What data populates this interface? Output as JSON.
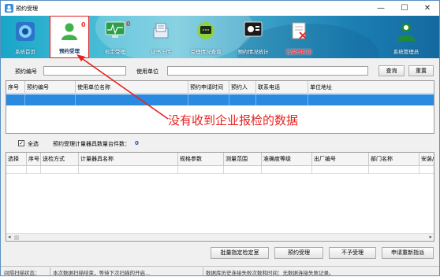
{
  "window": {
    "title": "预约受理",
    "controls": [
      "—",
      "☐",
      "✕"
    ]
  },
  "toolbar": {
    "items": [
      {
        "label": "系统首页",
        "icon": "home-icon"
      },
      {
        "label": "预约受理",
        "icon": "person-icon",
        "badge": "0",
        "active": true
      },
      {
        "label": "检定受理",
        "icon": "monitor-icon",
        "badge": "0"
      },
      {
        "label": "证书上传",
        "icon": "upload-icon"
      },
      {
        "label": "受理情况查询",
        "icon": "chat-icon"
      },
      {
        "label": "预约情况统计",
        "icon": "stats-icon"
      },
      {
        "label": "已受理打回",
        "icon": "return-icon",
        "red": true
      },
      {
        "label": "系统管理员",
        "icon": "admin-icon"
      }
    ]
  },
  "search": {
    "no_label": "预约编号",
    "unit_label": "使用单位",
    "no_value": "",
    "unit_value": "",
    "query_btn": "查询",
    "reset_btn": "重置"
  },
  "grid1": {
    "columns": [
      "序号",
      "预约编号",
      "使用单位名称",
      "预约申请时间",
      "预约人",
      "联系电话",
      "单位地址"
    ]
  },
  "annotation": {
    "message": "没有收到企业报检的数据"
  },
  "midbar": {
    "select_all_label": "全选",
    "select_all_checked": "✓",
    "count_label": "预约受理计量器具数量台件数：",
    "count_value": "0"
  },
  "grid2": {
    "columns": [
      "选择",
      "序号",
      "送检方式",
      "计量器具名称",
      "规格参数",
      "测量范围",
      "准确度等级",
      "出厂编号",
      "部门名称",
      "安装/"
    ]
  },
  "actions": {
    "batch_btn": "批量指定检定室",
    "accept_btn": "预约受理",
    "reject_btn": "不予受理",
    "reassign_btn": "申请重新指派"
  },
  "status": {
    "scan_label": "间隔扫描状态：",
    "scan_text": "本次数据扫描结束，等待下次扫描的开启...",
    "db_text": "数据库历史连接失败次数和时间：无数据连接失败记录。"
  }
}
